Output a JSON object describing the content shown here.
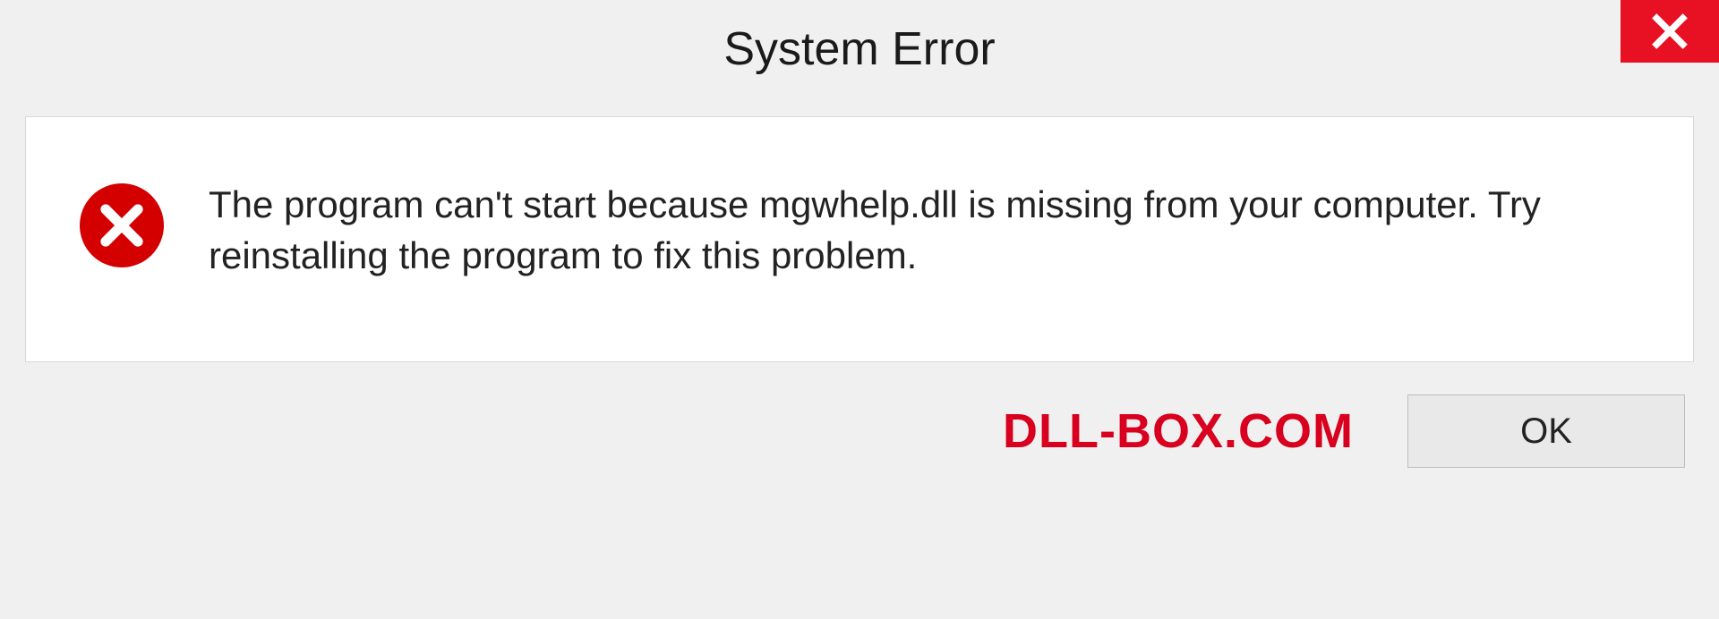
{
  "titlebar": {
    "title": "System Error"
  },
  "dialog": {
    "message": "The program can't start because mgwhelp.dll is missing from your computer. Try reinstalling the program to fix this problem."
  },
  "footer": {
    "watermark": "DLL-BOX.COM",
    "ok_label": "OK"
  },
  "colors": {
    "close_bg": "#e81123",
    "error_icon_bg": "#d40000",
    "watermark": "#d8001e"
  }
}
